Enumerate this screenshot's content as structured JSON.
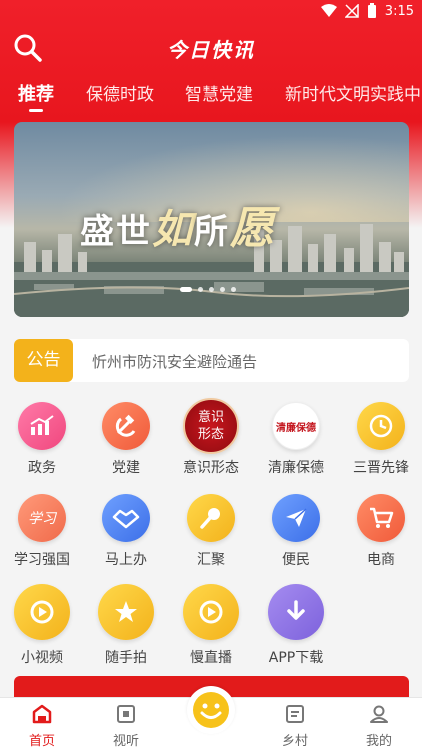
{
  "status": {
    "time": "3:15"
  },
  "header": {
    "title": "今日快讯"
  },
  "tabs": [
    "推荐",
    "保德时政",
    "智慧党建",
    "新时代文明实践中"
  ],
  "banner": {
    "slogan_1": "盛世",
    "slogan_2": "如",
    "slogan_3": "所",
    "slogan_4": "愿",
    "slides": 5,
    "active_slide": 0
  },
  "notice": {
    "tag": "公告",
    "text": "忻州市防汛安全避险通告"
  },
  "grid": {
    "row1": [
      "政务",
      "党建",
      "意识形态",
      "清廉保德",
      "三晋先锋"
    ],
    "row2": [
      "学习强国",
      "马上办",
      "汇聚",
      "便民",
      "电商"
    ],
    "row3": [
      "小视频",
      "随手拍",
      "慢直播",
      "APP下载"
    ],
    "icon_texts": {
      "yishi": "意识\n形态",
      "qinglian": "清廉保德",
      "xuexi": "学习"
    }
  },
  "bottom_nav": {
    "home": "首页",
    "video": "视听",
    "village": "乡村",
    "me": "我的"
  },
  "colors": {
    "brand_red": "#e8161e",
    "notice_yellow": "#f3b21b"
  }
}
